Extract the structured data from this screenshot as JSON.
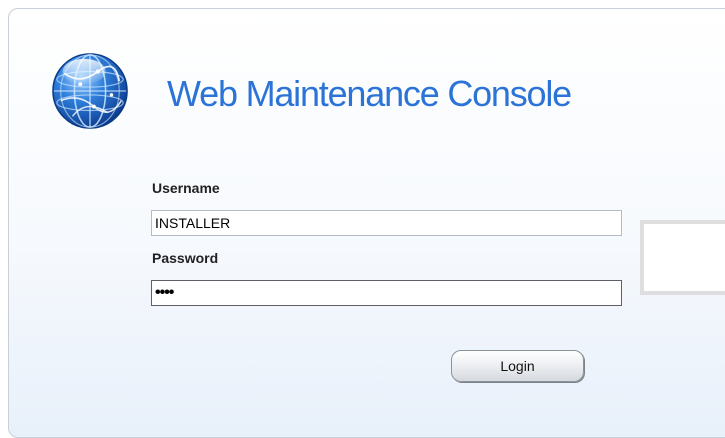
{
  "header": {
    "title": "Web Maintenance Console",
    "logo_icon": "globe-icon"
  },
  "login_form": {
    "username_label": "Username",
    "username_value": "INSTALLER",
    "password_label": "Password",
    "password_value": "••••",
    "login_label": "Login"
  },
  "colors": {
    "title": "#2b73d6",
    "panel_border": "#c9cfd6"
  }
}
